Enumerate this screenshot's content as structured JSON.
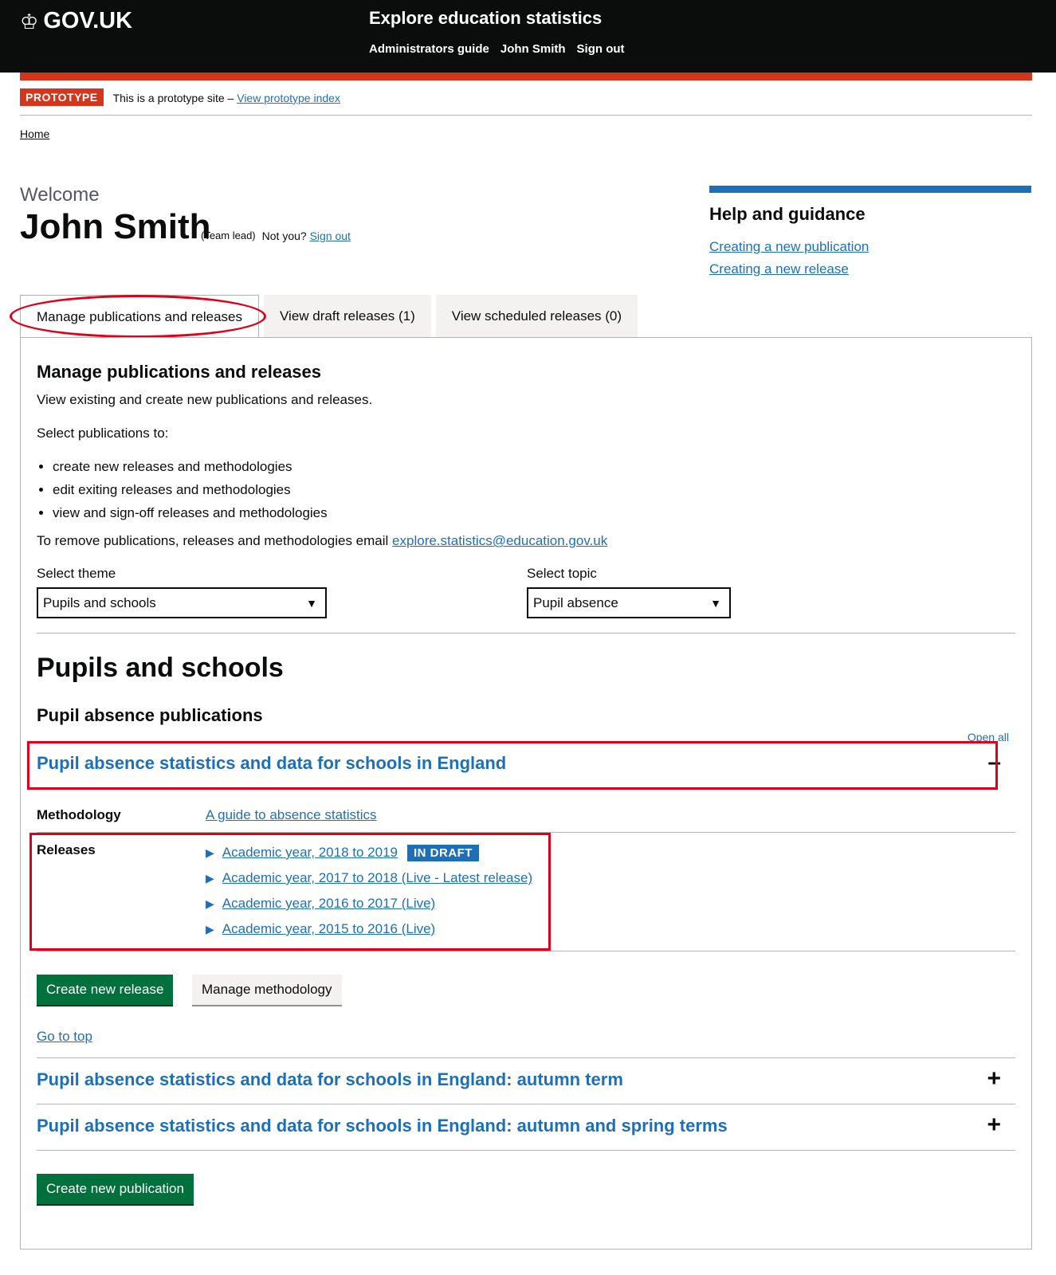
{
  "header": {
    "logo_text": "GOV.UK",
    "service_name": "Explore education statistics",
    "nav": [
      "Administrators guide",
      "John Smith",
      "Sign out"
    ]
  },
  "phase_banner": {
    "tag": "PROTOTYPE",
    "text": "This is a prototype site –",
    "link": "View prototype index"
  },
  "breadcrumb": {
    "home": "Home"
  },
  "welcome": {
    "caption": "Welcome",
    "name": "John Smith",
    "role": "(Team lead)",
    "not_you": "Not you?",
    "sign_out": "Sign out"
  },
  "help": {
    "title": "Help and guidance",
    "links": [
      "Creating a new publication",
      "Creating a new release"
    ]
  },
  "tabs": [
    {
      "label": "Manage publications and releases",
      "active": true
    },
    {
      "label": "View draft releases (1)",
      "active": false
    },
    {
      "label": "View scheduled releases (0)",
      "active": false
    }
  ],
  "panel": {
    "title": "Manage publications and releases",
    "intro": "View existing and create new publications and releases.",
    "select_intro": "Select publications to:",
    "bullets": [
      "create new releases and methodologies",
      "edit exiting releases and methodologies",
      "view and sign-off releases and methodologies"
    ],
    "remove_text": "To remove publications, releases and methodologies email",
    "remove_email": "explore.statistics@education.gov.uk",
    "theme_label": "Select theme",
    "theme_value": "Pupils and schools",
    "topic_label": "Select topic",
    "topic_value": "Pupil absence",
    "theme_heading": "Pupils and schools",
    "topic_heading": "Pupil absence publications",
    "open_all": "Open all"
  },
  "publications": [
    {
      "title": "Pupil absence statistics and data for schools in England",
      "expanded": true,
      "sign": "–",
      "methodology_label": "Methodology",
      "methodology_link": "A guide to absence statistics",
      "releases_label": "Releases",
      "releases": [
        {
          "label": "Academic year, 2018 to 2019",
          "tag": "IN DRAFT"
        },
        {
          "label": "Academic year, 2017 to 2018 (Live - Latest release)"
        },
        {
          "label": "Academic year, 2016 to 2017 (Live)"
        },
        {
          "label": "Academic year, 2015 to 2016 (Live)"
        }
      ],
      "create_release": "Create new release",
      "manage_methodology": "Manage methodology"
    },
    {
      "title": "Pupil absence statistics and data for schools in England: autumn term",
      "expanded": false,
      "sign": "+"
    },
    {
      "title": "Pupil absence statistics and data for schools in England: autumn and spring terms",
      "expanded": false,
      "sign": "+"
    }
  ],
  "go_to_top": "Go to top",
  "create_publication": "Create new publication",
  "colors": {
    "header_bg": "#0b0c0c",
    "accent_red": "#d4351c",
    "link_blue": "#1d70b8",
    "button_green": "#00703c",
    "annotation_red": "#e0001b"
  }
}
